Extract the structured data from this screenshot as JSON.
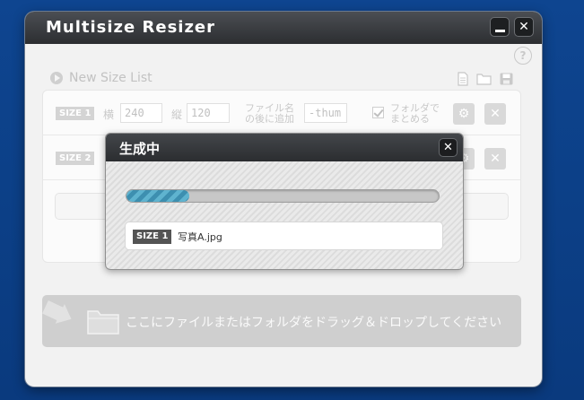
{
  "app": {
    "title": "Multisize Resizer"
  },
  "window_controls": {
    "minimize_icon": "minimize-icon",
    "close_glyph": "✕"
  },
  "help": {
    "glyph": "?"
  },
  "size_list": {
    "header": "New Size List",
    "rows": [
      {
        "badge": "SIZE 1",
        "width_label": "横",
        "width_value": "240",
        "height_label": "縦",
        "height_value": "120",
        "suffix_label_line1": "ファイル名",
        "suffix_label_line2": "の後に追加",
        "suffix_value": "-thum",
        "folder_label_line1": "フォルダで",
        "folder_label_line2": "まとめる",
        "folder_checked": true
      },
      {
        "badge": "SIZE 2"
      }
    ],
    "gear_glyph": "⚙",
    "delete_glyph": "✕"
  },
  "drop_zone": {
    "text": "ここにファイルまたはフォルダをドラッグ＆ドロップしてください"
  },
  "progress_dialog": {
    "title": "生成中",
    "close_glyph": "✕",
    "progress": 0.2,
    "current_badge": "SIZE 1",
    "current_file": "写真A.jpg"
  },
  "colors": {
    "desktop": "#0d3f85",
    "titlebar": "#2c2e31",
    "progress_fill": "#4fa3c4"
  }
}
